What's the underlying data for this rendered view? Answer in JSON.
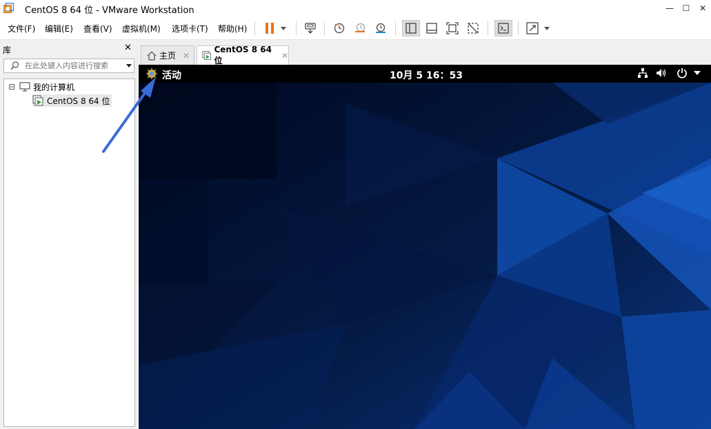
{
  "window": {
    "title": "CentOS 8 64 位 - VMware Workstation",
    "controls": {
      "minimize": "—",
      "maximize": "☐",
      "close": "✕"
    }
  },
  "menubar": {
    "items": [
      "文件(F)",
      "编辑(E)",
      "查看(V)",
      "虚拟机(M)",
      "选项卡(T)",
      "帮助(H)"
    ]
  },
  "toolbar": {
    "icons": [
      "pause-icon",
      "dropdown-arrow-icon",
      "send-ctrl-alt-del-icon",
      "snapshot-icon",
      "revert-snapshot-icon",
      "snapshot-manager-icon",
      "show-library-icon",
      "thumbnail-bar-icon",
      "full-screen-icon",
      "disable-unity-icon",
      "console-view-icon",
      "stretch-icon",
      "dropdown-arrow-icon"
    ],
    "accent_color": "#e8731c"
  },
  "library": {
    "title": "库",
    "close_glyph": "✕",
    "search_placeholder": "在此处键入内容进行搜索",
    "tree": {
      "root_label": "我的计算机",
      "expander": "⊟",
      "children": [
        "CentOS 8 64 位"
      ]
    }
  },
  "tabs": [
    {
      "label": "主页",
      "icon": "home-icon",
      "close": "✕",
      "active": false
    },
    {
      "label": "CentOS 8 64 位",
      "icon": "vm-running-icon",
      "close": "✕",
      "active": true
    }
  ],
  "guest": {
    "top_bar": {
      "activities_label": "活动",
      "clock": "10月 5  16：53",
      "tray_icons": [
        "network-icon",
        "volume-icon",
        "power-icon",
        "menu-arrow-icon"
      ]
    },
    "wallpaper_colors": [
      "#000a1e",
      "#0a3d8c",
      "#1a5cc0"
    ]
  }
}
